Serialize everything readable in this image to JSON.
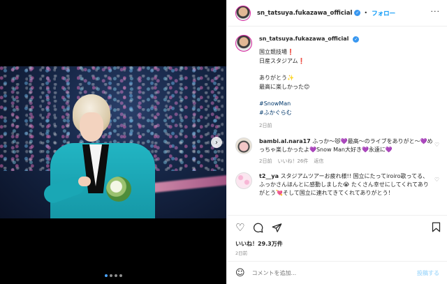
{
  "post": {
    "username": "sn_tatsuya.fukazawa_official",
    "follow_label": "フォロー",
    "more_label": "···",
    "caption_lines": [
      "国立競技場❗️",
      "日産スタジアム❗️",
      "",
      "ありがとう✨",
      "最高に楽しかった😊",
      "",
      "#SnowMan",
      "#ふかぐらむ"
    ],
    "caption_age": "2日前",
    "likes_label": "いいね！29.3万件",
    "date_label": "2日前",
    "comment_placeholder": "コメントを追加...",
    "post_label": "投稿する"
  },
  "comments": [
    {
      "user": "bambi.al.nara17",
      "text": "ふっか〜😻💜最高〜のライブをありがと〜💜めっちゃ楽しかったよ💜Snow Man大好き💜永遠に💜",
      "age": "2日前",
      "likes": "いいね！26件",
      "reply": "返信"
    },
    {
      "user": "t2__ya",
      "text": "スタジアムツアーお疲れ様!! 国立にたってiroiro歌ってる、ふっかさんほんとに感動しました😭 たくさん幸せにしてくれてありがとう💘そして国立に連れてきてくれてありがとう！",
      "age": "",
      "likes": "",
      "reply": ""
    }
  ],
  "icons": {
    "next": "chevron-right-icon",
    "like": "heart-icon",
    "comment": "comment-icon",
    "share": "paper-plane-icon",
    "save": "bookmark-icon",
    "emoji": "smiley-icon"
  },
  "carousel": {
    "count": 4,
    "active_index": 0
  },
  "colors": {
    "accent": "#0095f6",
    "verified": "#3897f0",
    "suit": "#1aa7b5"
  }
}
